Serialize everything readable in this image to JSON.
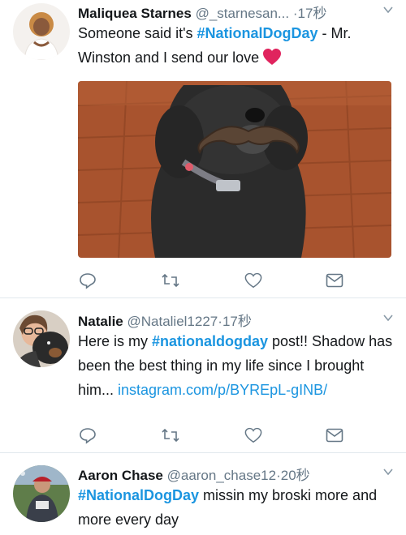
{
  "colors": {
    "accent": "#1b95e0",
    "muted": "#657786",
    "text": "#14171a",
    "divider": "#e1e8ed",
    "heart": "#e0245e"
  },
  "tweets": [
    {
      "name": "Maliquea Starnes",
      "handle": "@_starnesan...",
      "separator": "·",
      "time": "17秒",
      "text_before": "Someone said it's ",
      "hashtag": "#NationalDogDay",
      "text_after": " - Mr. Winston and I send our love",
      "emoji": "heart-emoji",
      "media": "dog-photo-with-mustache"
    },
    {
      "name": "Natalie",
      "handle": "@Nataliel1227",
      "separator": "·",
      "time": "17秒",
      "text_before": "Here is my ",
      "hashtag": "#nationaldogday",
      "text_after": " post!! Shadow has been the best thing in my life since I brought him... ",
      "link": "instagram.com/p/BYREpL-gINB/"
    },
    {
      "name": "Aaron Chase",
      "handle": "@aaron_chase12",
      "separator": "·",
      "time": "20秒",
      "hashtag": "#NationalDogDay",
      "text_after": " missin my broski more and more every day"
    }
  ],
  "icons": [
    "reply-icon",
    "retweet-icon",
    "like-icon",
    "message-icon",
    "chevron-down-icon"
  ]
}
